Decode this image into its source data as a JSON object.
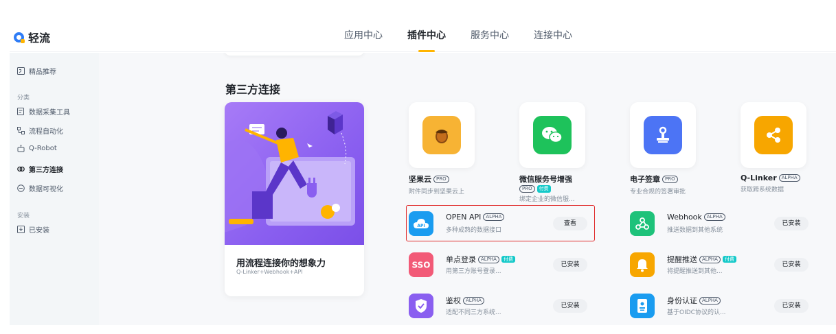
{
  "app": {
    "name": "轻流"
  },
  "nav": {
    "tabs": [
      {
        "label": "应用中心"
      },
      {
        "label": "插件中心"
      },
      {
        "label": "服务中心"
      },
      {
        "label": "连接中心"
      }
    ],
    "active": "插件中心"
  },
  "sidebar": {
    "featured": "精品推荐",
    "group_category": "分类",
    "items": [
      {
        "label": "数据采集工具"
      },
      {
        "label": "流程自动化"
      },
      {
        "label": "Q-Robot"
      },
      {
        "label": "第三方连接"
      },
      {
        "label": "数据可视化"
      }
    ],
    "group_install": "安装",
    "installed": "已安装"
  },
  "section": {
    "title": "第三方连接"
  },
  "feature": {
    "title": "用流程连接你的想象力",
    "subtitle": "Q-Linker+Webhook+API"
  },
  "big_apps": [
    {
      "name": "坚果云",
      "tag": "PRO",
      "desc": "附件同步到坚果云上",
      "icon": "acorn-icon",
      "color": "#f7b334"
    },
    {
      "name": "微信服务号增强",
      "tag": "PRO",
      "paid": "付费",
      "desc": "绑定企业的微信服...",
      "icon": "wechat-icon",
      "color": "#1ec25b"
    },
    {
      "name": "电子签章",
      "tag": "PRO",
      "desc": "专业合规的签署审批",
      "icon": "stamp-icon",
      "color": "#4c74f5"
    },
    {
      "name": "Q-Linker",
      "tag": "ALPHA",
      "desc": "获取跨系统数据",
      "icon": "share-icon",
      "color": "#f7a600"
    }
  ],
  "row_apps": [
    {
      "name": "OPEN API",
      "tag": "ALPHA",
      "desc": "多种成熟的数据接口",
      "button": "查看",
      "icon": "api-cloud-icon",
      "color": "#1a9cf0"
    },
    {
      "name": "Webhook",
      "tag": "ALPHA",
      "desc": "推送数据到其他系统",
      "button": "已安装",
      "icon": "webhook-icon",
      "color": "#1ec27a"
    },
    {
      "name": "单点登录",
      "tag": "ALPHA",
      "paid": "付费",
      "desc": "用第三方账号登录...",
      "button": "已安装",
      "icon": "sso-icon",
      "color": "#f25a77"
    },
    {
      "name": "提醒推送",
      "tag": "ALPHA",
      "paid": "付费",
      "desc": "将提醒推送到其他...",
      "button": "已安装",
      "icon": "bell-icon",
      "color": "#f7a600"
    },
    {
      "name": "鉴权",
      "tag": "ALPHA",
      "desc": "适配不同三方系统...",
      "button": "已安装",
      "icon": "shield-icon",
      "color": "#8a5ff0"
    },
    {
      "name": "身份认证",
      "tag": "ALPHA",
      "desc": "基于OIDC协议的认...",
      "button": "已安装",
      "icon": "id-card-icon",
      "color": "#1a9cf0"
    }
  ],
  "colors": {
    "accent": "#ffb400",
    "highlight_border": "#e02a2a",
    "paid_tag": "#14c9c9"
  }
}
